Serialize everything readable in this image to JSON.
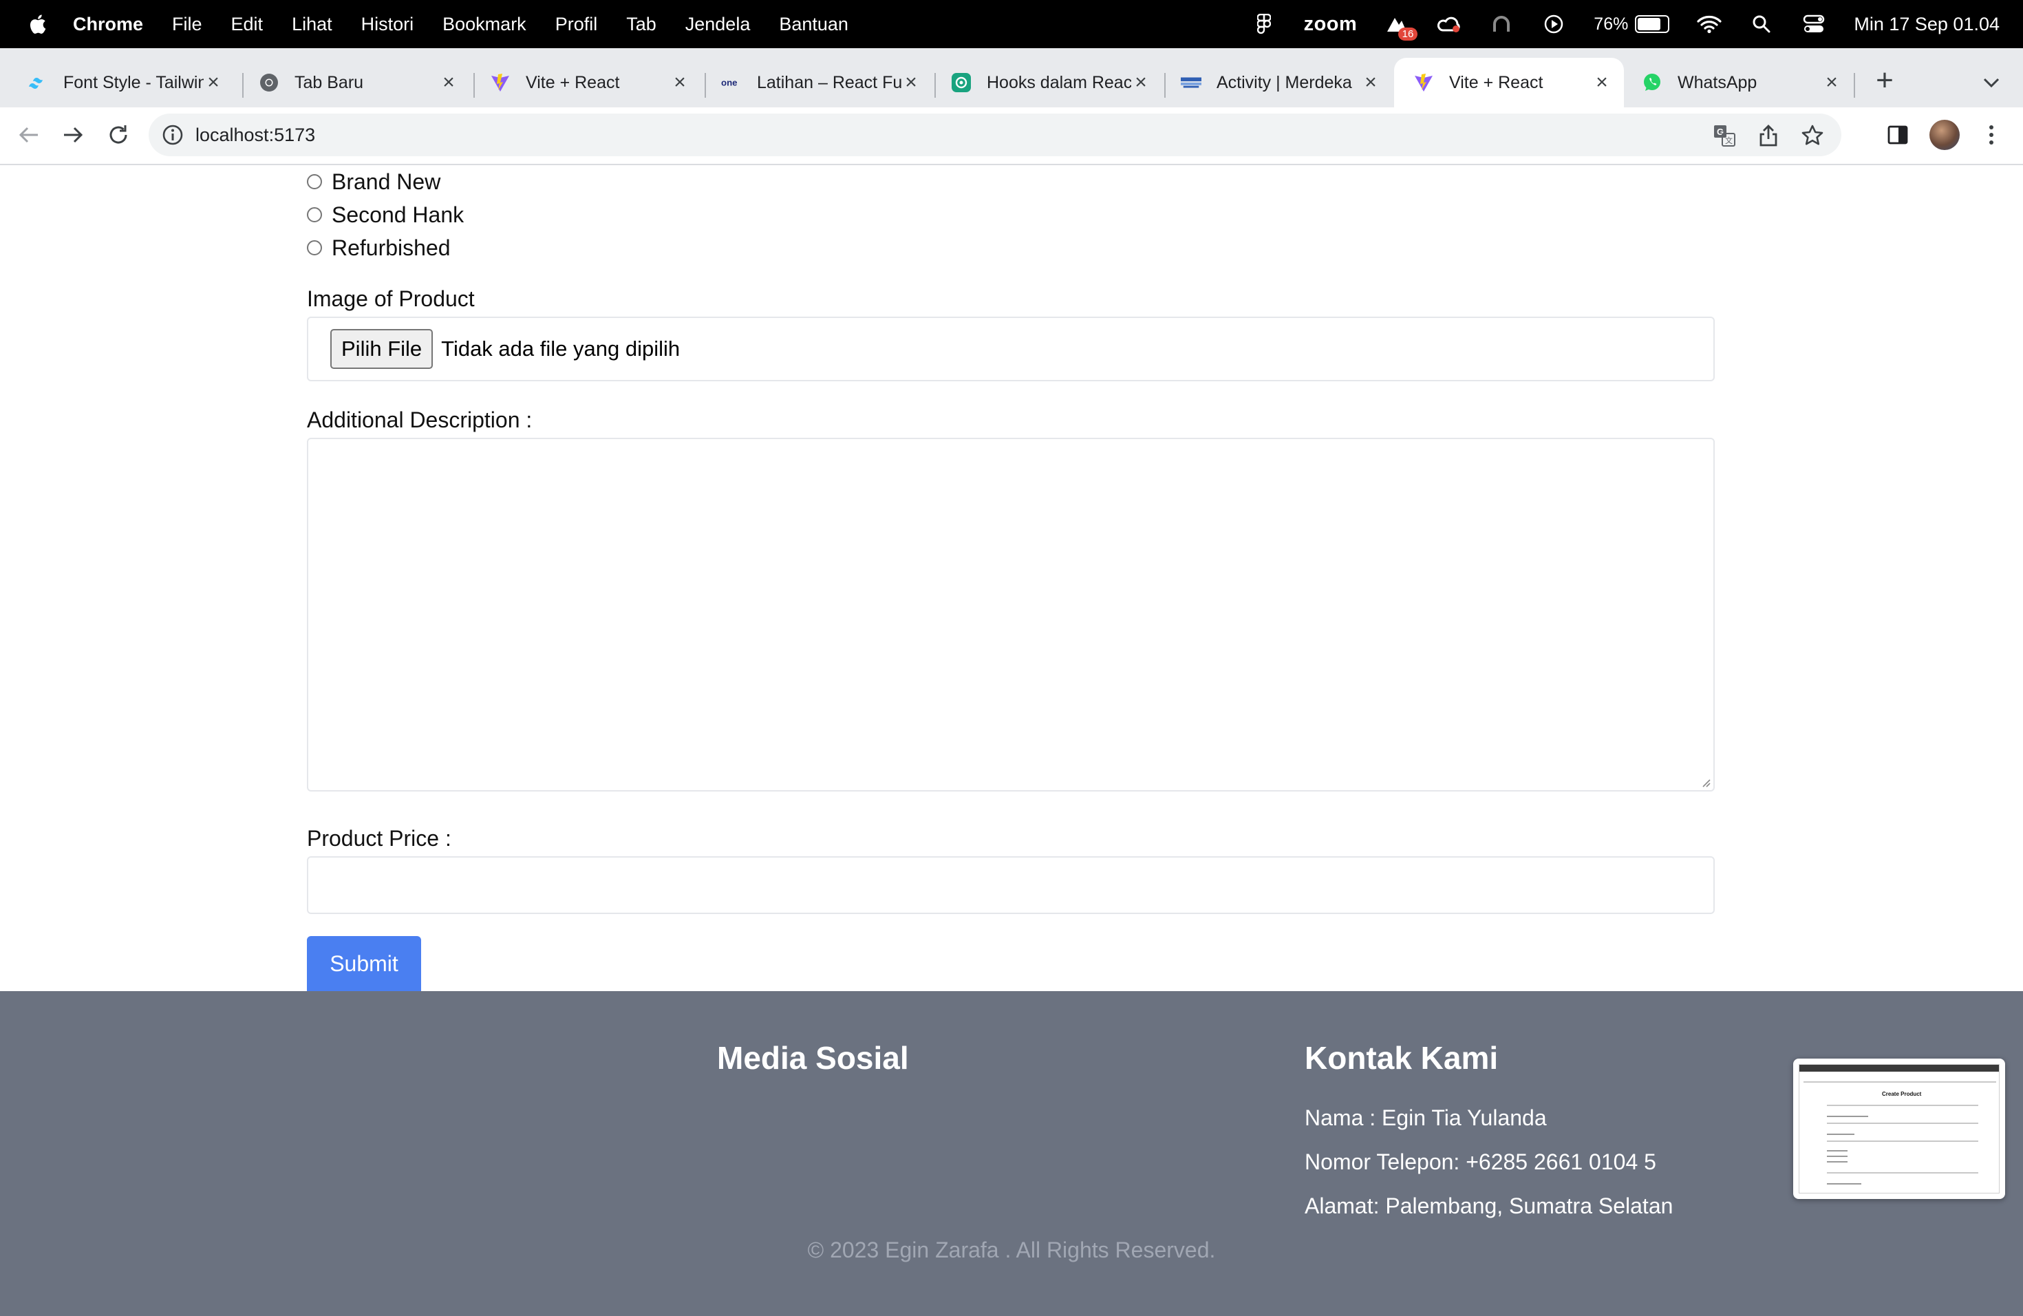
{
  "menubar": {
    "app_name": "Chrome",
    "items": [
      "File",
      "Edit",
      "Lihat",
      "Histori",
      "Bookmark",
      "Profil",
      "Tab",
      "Jendela",
      "Bantuan"
    ],
    "zoom_label": "zoom",
    "notification_count": "16",
    "battery_percent": "76%",
    "clock": "Min 17 Sep  01.04"
  },
  "tabs": [
    {
      "title": "Font Style - Tailwind",
      "icon": "tailwind-icon"
    },
    {
      "title": "Tab Baru",
      "icon": "chrome-icon"
    },
    {
      "title": "Vite + React",
      "icon": "vite-icon"
    },
    {
      "title": "Latihan – React Fu",
      "icon": "oneb-icon"
    },
    {
      "title": "Hooks dalam React",
      "icon": "openai-icon"
    },
    {
      "title": "Activity | Merdeka",
      "icon": "merdeka-icon"
    },
    {
      "title": "Vite + React",
      "icon": "vite-icon",
      "active": true
    },
    {
      "title": "WhatsApp",
      "icon": "whatsapp-icon"
    }
  ],
  "address_bar": {
    "url": "localhost:5173"
  },
  "form": {
    "condition_options": [
      "Brand New",
      "Second Hank",
      "Refurbished"
    ],
    "image_label": "Image of Product",
    "file_button": "Pilih File",
    "file_status": "Tidak ada file yang dipilih",
    "description_label": "Additional Description :",
    "description_value": "",
    "price_label": "Product Price :",
    "price_value": "",
    "submit_label": "Submit"
  },
  "footer": {
    "social_heading": "Media Sosial",
    "contact_heading": "Kontak Kami",
    "contact_name": "Nama : Egin Tia Yulanda",
    "contact_phone": "Nomor Telepon: +6285 2661 0104 5",
    "contact_address": "Alamat: Palembang, Sumatra Selatan",
    "copyright": "© 2023 Egin Zarafa . All Rights Reserved."
  },
  "thumbnail": {
    "title": "Create Product"
  },
  "colors": {
    "submit": "#4a7ff1",
    "footer_bg": "#6b7280",
    "tabstrip_bg": "#e8eaed"
  }
}
